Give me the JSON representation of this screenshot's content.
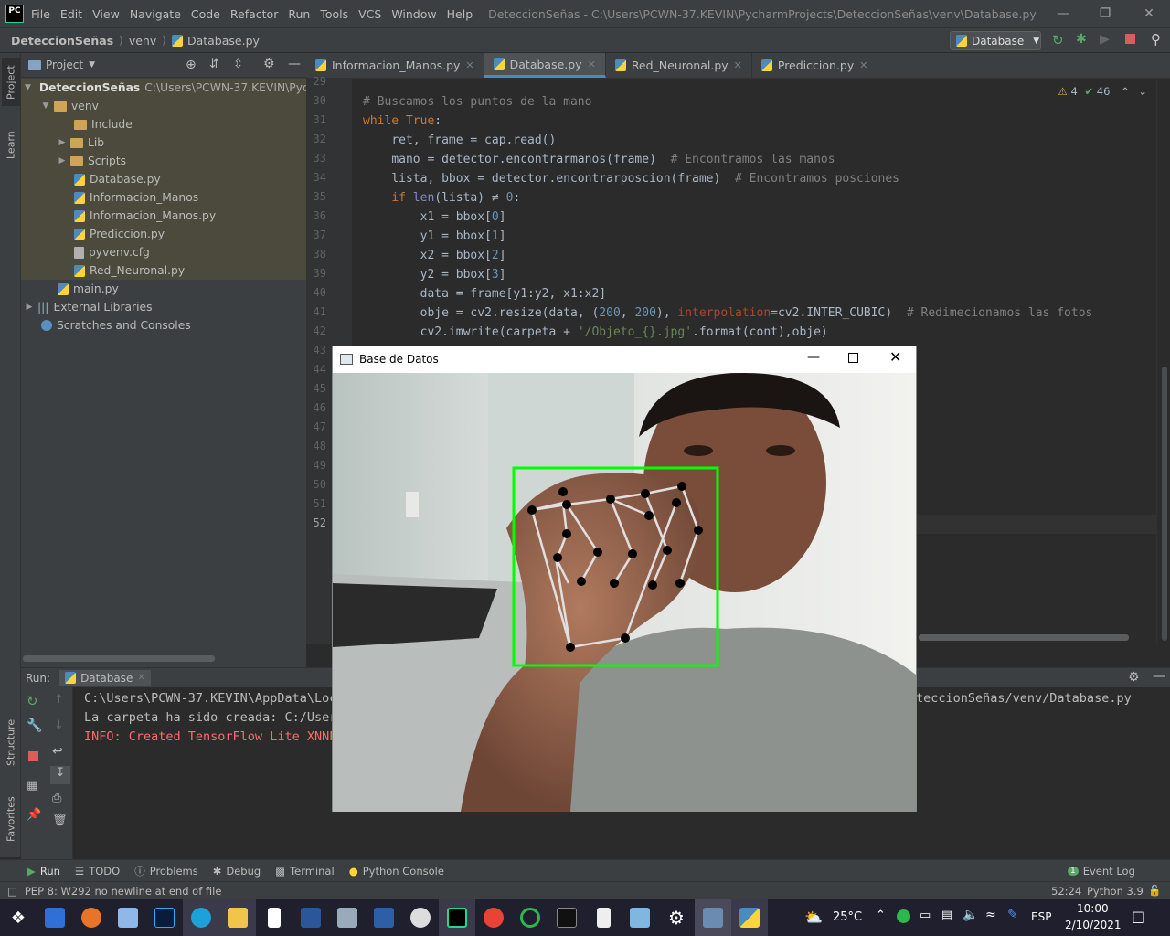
{
  "window": {
    "title": "DeteccionSeñas - C:\\Users\\PCWN-37.KEVIN\\PycharmProjects\\DeteccionSeñas\\venv\\Database.py"
  },
  "menu": [
    "File",
    "Edit",
    "View",
    "Navigate",
    "Code",
    "Refactor",
    "Run",
    "Tools",
    "VCS",
    "Window",
    "Help"
  ],
  "breadcrumb": {
    "project": "DeteccionSeñas",
    "folder": "venv",
    "file": "Database.py"
  },
  "run_config": "Database",
  "side_tabs": {
    "project": "Project",
    "learn": "Learn",
    "structure": "Structure",
    "favorites": "Favorites"
  },
  "project_panel": {
    "title": "Project",
    "root": "DeteccionSeñas",
    "root_path": "C:\\Users\\PCWN-37.KEVIN\\Pychar",
    "items": [
      {
        "label": "venv",
        "kind": "folder"
      },
      {
        "label": "Include",
        "kind": "folder"
      },
      {
        "label": "Lib",
        "kind": "folder"
      },
      {
        "label": "Scripts",
        "kind": "folder"
      },
      {
        "label": "Database.py",
        "kind": "py"
      },
      {
        "label": "Informacion_Manos",
        "kind": "py"
      },
      {
        "label": "Informacion_Manos.py",
        "kind": "py"
      },
      {
        "label": "Prediccion.py",
        "kind": "py"
      },
      {
        "label": "pyvenv.cfg",
        "kind": "cfg"
      },
      {
        "label": "Red_Neuronal.py",
        "kind": "py"
      },
      {
        "label": "main.py",
        "kind": "py"
      },
      {
        "label": "External Libraries",
        "kind": "lib"
      },
      {
        "label": "Scratches and Consoles",
        "kind": "scratch"
      }
    ]
  },
  "editor_tabs": [
    "Informacion_Manos.py",
    "Database.py",
    "Red_Neuronal.py",
    "Prediccion.py"
  ],
  "inspections": {
    "warnings": "4",
    "ok": "46"
  },
  "line_numbers": [
    "29",
    "30",
    "31",
    "32",
    "33",
    "34",
    "35",
    "36",
    "37",
    "38",
    "39",
    "40",
    "41",
    "42",
    "43",
    "44",
    "45",
    "46",
    "47",
    "48",
    "49",
    "50",
    "51",
    "52"
  ],
  "code": {
    "l30": "# Buscamos los puntos de la mano",
    "l31_kw": "while True",
    "l32": "ret, frame = cap.read()",
    "l33_a": "mano = detector.encontrarmanos(frame)  ",
    "l33_c": "# Encontramos las manos",
    "l34_a": "lista, bbox = detector.encontrarposcion(frame)  ",
    "l34_c": "# Encontramos posciones",
    "l35_kw": "if ",
    "l35_b": "len",
    "l35_r": "(lista) ≠ ",
    "l35_n": "0",
    "l36": "x1 = bbox[",
    "l36_n": "0",
    "l37": "y1 = bbox[",
    "l37_n": "1",
    "l38": "x2 = bbox[",
    "l38_n": "2",
    "l39": "y2 = bbox[",
    "l39_n": "3",
    "l40": "data = frame[y1:y2, x1:x2]",
    "l41_a": "obje = cv2.resize(data, (",
    "l41_n1": "200",
    "l41_n2": "200",
    "l41_p": "interpolation",
    "l41_b": "=cv2.INTER_CUBIC)  ",
    "l41_c": "# Redimecionamos las fotos",
    "l42_a": "cv2.imwrite(carpeta + ",
    "l42_s": "'/Objeto_{}.jpg'",
    "l42_b": ".format(cont),obje)"
  },
  "run_panel": {
    "label": "Run:",
    "config": "Database"
  },
  "console": [
    "C:\\Users\\PCWN-37.KEVIN\\AppData\\Loc",
    "La carpeta ha sido creada: C:/User",
    "INFO: Created TensorFlow Lite XNNP",
    "teccionSeñas/venv/Database.py"
  ],
  "tool_tabs": [
    "Run",
    "TODO",
    "Problems",
    "Debug",
    "Terminal",
    "Python Console",
    "Event Log"
  ],
  "event_log_count": "1",
  "status": {
    "message": "PEP 8: W292 no newline at end of file",
    "position": "52:24",
    "interpreter": "Python 3.9"
  },
  "cv_window": {
    "title": "Base de Datos"
  },
  "taskbar": {
    "weather": "25°C",
    "lang": "ESP",
    "time": "10:00",
    "date": "2/10/2021"
  },
  "colors": {
    "accent": "#4a88c7",
    "keyword": "#cc7832",
    "comment": "#808080",
    "string": "#6a8759",
    "number": "#6897bb",
    "error": "#ff6b68",
    "box": "#00ff00"
  }
}
